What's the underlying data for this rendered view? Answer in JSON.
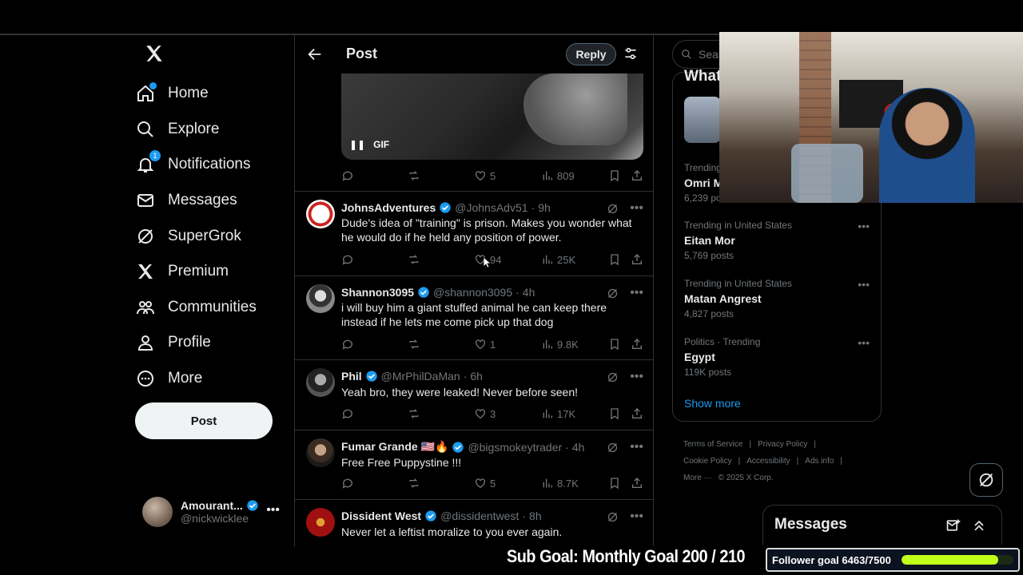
{
  "nav": {
    "items": [
      {
        "label": "Home",
        "icon": "home-icon"
      },
      {
        "label": "Explore",
        "icon": "search-icon"
      },
      {
        "label": "Notifications",
        "icon": "bell-icon",
        "badge": "1"
      },
      {
        "label": "Messages",
        "icon": "envelope-icon"
      },
      {
        "label": "SuperGrok",
        "icon": "grok-icon"
      },
      {
        "label": "Premium",
        "icon": "x-logo-icon"
      },
      {
        "label": "Communities",
        "icon": "people-icon"
      },
      {
        "label": "Profile",
        "icon": "person-icon"
      },
      {
        "label": "More",
        "icon": "more-circle-icon"
      }
    ],
    "post_label": "Post"
  },
  "account": {
    "name": "Amourant...",
    "handle": "@nickwicklee"
  },
  "header": {
    "title": "Post",
    "reply_label": "Reply"
  },
  "gif": {
    "label": "GIF"
  },
  "first_actions": {
    "likes": "5",
    "views": "809"
  },
  "tweets": [
    {
      "name": "JohnsAdventures",
      "handle": "@JohnsAdv51",
      "time": "9h",
      "text": "Dude's idea of \"training\" is prison. Makes you wonder what he would do if he held any position of power.",
      "replies": "",
      "retweets": "",
      "likes": "94",
      "views": "25K"
    },
    {
      "name": "Shannon3095",
      "handle": "@shannon3095",
      "time": "4h",
      "text": "i will buy him a giant stuffed animal he can keep there instead if he lets me come pick up that dog",
      "replies": "",
      "retweets": "",
      "likes": "1",
      "views": "9.8K"
    },
    {
      "name": "Phil",
      "handle": "@MrPhilDaMan",
      "time": "6h",
      "text": "Yeah bro, they were leaked! Never before seen!",
      "replies": "",
      "retweets": "",
      "likes": "3",
      "views": "17K"
    },
    {
      "name": "Fumar Grande 🇺🇸🔥",
      "handle": "@bigsmokeytrader",
      "time": "4h",
      "text": "Free Free Puppystine !!!",
      "replies": "",
      "retweets": "",
      "likes": "5",
      "views": "8.7K"
    },
    {
      "name": "Dissident West",
      "handle": "@dissidentwest",
      "time": "8h",
      "text": "Never let a leftist moralize to you ever again.",
      "replies": "",
      "retweets": "",
      "likes": "",
      "views": ""
    }
  ],
  "search": {
    "placeholder": "Search"
  },
  "trends": [
    {
      "context": "Trending",
      "name": "Omri M",
      "count": "6,239 po"
    },
    {
      "context": "Trending in United States",
      "name": "Eitan Mor",
      "count": "5,769 posts"
    },
    {
      "context": "Trending in United States",
      "name": "Matan Angrest",
      "count": "4,827 posts"
    },
    {
      "context": "Politics · Trending",
      "name": "Egypt",
      "count": "119K posts"
    }
  ],
  "trends_title": "What",
  "show_more": "Show more",
  "footer": {
    "links": [
      "Terms of Service",
      "|",
      "Privacy Policy",
      "|",
      "Cookie Policy",
      "|",
      "Accessibility",
      "|",
      "Ads info",
      "|",
      "More ···",
      "© 2025 X Corp."
    ]
  },
  "messages_dock": {
    "title": "Messages"
  },
  "overlay": {
    "sub_goal": "Sub Goal: Monthly Goal  200 / 210",
    "follower_goal": "Follower goal 6463/7500",
    "follower_progress": 0.8617
  },
  "colors": {
    "accent": "#1d9bf0",
    "bg": "#000000",
    "muted": "#71767b",
    "progress": "#c2ff1a"
  }
}
